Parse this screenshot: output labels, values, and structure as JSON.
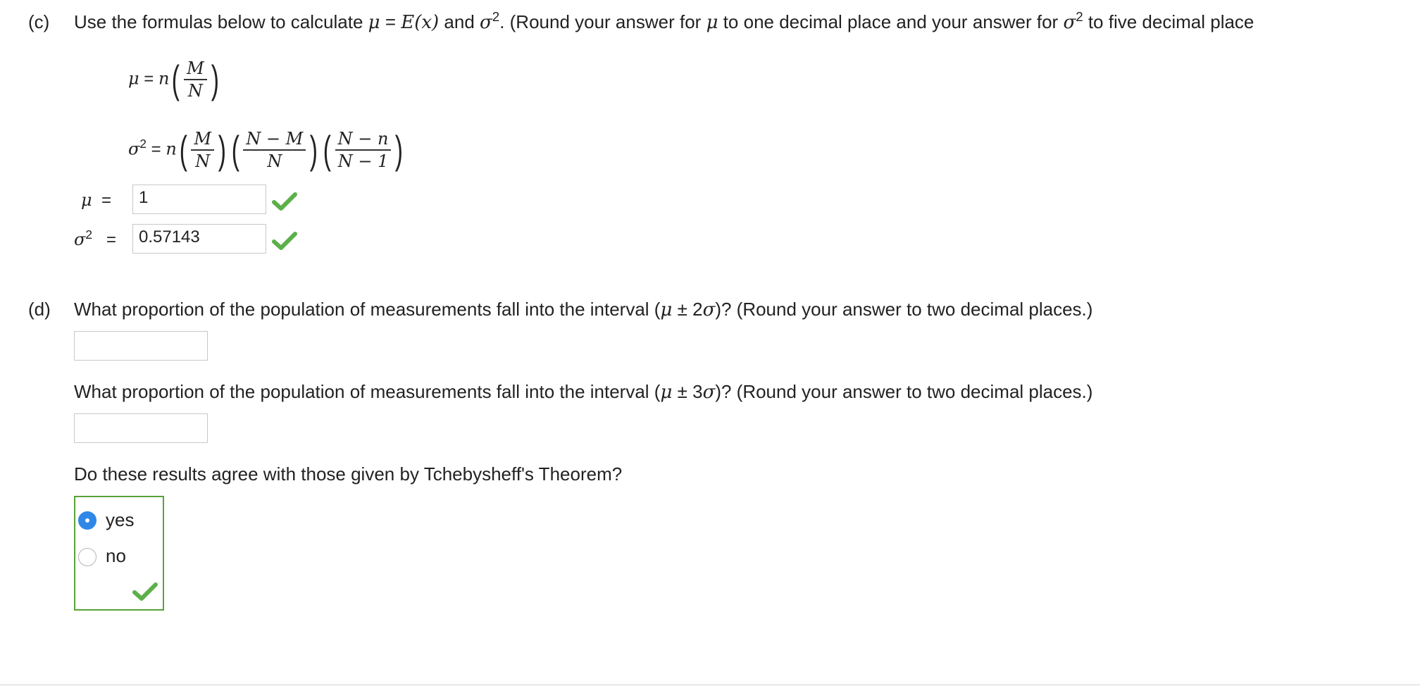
{
  "part_c": {
    "label": "(c)",
    "intro": "Use the formulas below to calculate",
    "mu_symbol": "μ",
    "eq": "=",
    "expectation": "E(x)",
    "and": "and",
    "sigma_symbol": "σ",
    "squared": "2",
    "rest": ". (Round your answer for",
    "rest2": "to one decimal place and your answer for",
    "rest3": "to five decimal place",
    "formula_n": "n",
    "formula_M": "M",
    "formula_N": "N",
    "formula_N_minus_M": "N − M",
    "formula_N_minus_n": "N − n",
    "formula_N_minus_1": "N − 1",
    "answers": {
      "mu_value": "1",
      "sigma2_value": "0.57143"
    }
  },
  "part_d": {
    "label": "(d)",
    "q1_prefix": "What proportion of the population of measurements fall into the interval (",
    "q1_pm": "± 2",
    "q1_suffix": ")? (Round your answer to two decimal places.)",
    "q1_answer": "",
    "q2_prefix": "What proportion of the population of measurements fall into the interval (",
    "q2_pm": "± 3",
    "q2_suffix": ")? (Round your answer to two decimal places.)",
    "q2_answer": "",
    "q3": "Do these results agree with those given by Tchebysheff's Theorem?",
    "options": [
      "yes",
      "no"
    ],
    "selected": "yes"
  },
  "colors": {
    "check_green": "#5cb04a",
    "radio_blue": "#2f88e8",
    "box_green": "#59a339"
  },
  "icons": {
    "correct": "check-icon"
  }
}
